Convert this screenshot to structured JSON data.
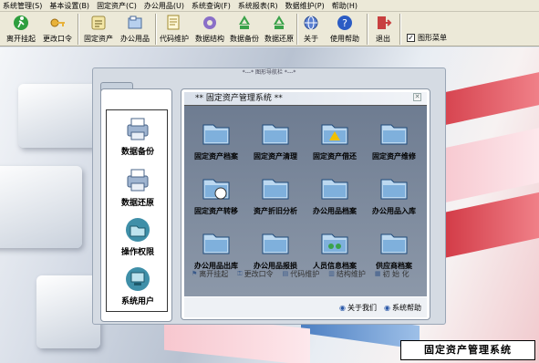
{
  "menubar": {
    "items": [
      "系统管理(S)",
      "基本设置(B)",
      "固定资产(C)",
      "办公用品(U)",
      "系统查询(F)",
      "系统报表(R)",
      "数据维护(P)",
      "帮助(H)"
    ]
  },
  "toolbar": {
    "buttons": [
      "离开挂起",
      "更改口令",
      "固定资产",
      "办公用品",
      "代码维护",
      "数据结构",
      "数据备份",
      "数据还原",
      "关于",
      "使用帮助",
      "退出"
    ],
    "checkbox_label": "图形菜单",
    "checkbox_checked": true
  },
  "window": {
    "title": "*---* 图形导航栏 *---*",
    "left_items": [
      "数据备份",
      "数据还原",
      "操作权限",
      "系统用户"
    ],
    "panel_title": "** 固定资产管理系统 **",
    "close_glyph": "✕",
    "modules": [
      "固定资产档案",
      "固定资产清理",
      "固定资产借还",
      "固定资产维修",
      "固定资产转移",
      "资产折旧分析",
      "办公用品档案",
      "办公用品入库",
      "办公用品出库",
      "办公用品报损",
      "人员信息档案",
      "供应商档案"
    ],
    "links": [
      "离开挂起",
      "更改口令",
      "代码维护",
      "结构维护",
      "初 始 化"
    ],
    "bottom_links": [
      "关于我们",
      "系统帮助"
    ]
  },
  "footer_label": "固定资产管理系统",
  "colors": {
    "toolbar_bg": "#ece9d8",
    "panel_dark": "#6e7c91",
    "accent_blue": "#2a58a8"
  },
  "icons": {
    "toolbar": [
      "runner-icon",
      "key-icon",
      "asset-icon",
      "supplies-icon",
      "code-icon",
      "gear-icon",
      "recycle-icon",
      "recycle-icon",
      "globe-icon",
      "help-icon",
      "exit-icon"
    ],
    "left": [
      "printer-icon",
      "printer-icon",
      "folder-icon",
      "computer-icon"
    ],
    "modules": [
      "folder-icon",
      "folder-icon",
      "folder-icon",
      "folder-icon"
    ]
  }
}
